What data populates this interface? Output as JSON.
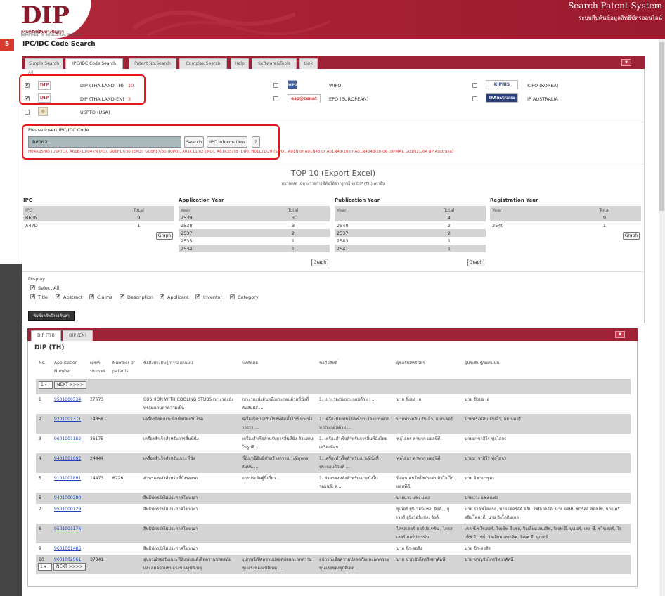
{
  "header": {
    "logo_text": "DIP",
    "logo_sub_th": "กรมทรัพย์สินทางปัญญา",
    "logo_sub_en": "DEPARTMENT OF INTELLECTUAL PROPERTY",
    "title": "Search Patent System",
    "subtitle": "ระบบสืบค้นข้อมูลสิทธิบัตรออนไลน์"
  },
  "step_badge": "5",
  "page_title": "IPC/IDC Code Search",
  "tabs": [
    "Simple Search",
    "IPC/IDC Code Search",
    "Patent No.Search",
    "Complex Search",
    "Help",
    "Software&Tools",
    "Link"
  ],
  "tab_toggle": "▼",
  "sources": {
    "all_label": "All",
    "items": [
      {
        "logo": "DIP",
        "label": "DIP (THAILAND-TH)",
        "count": "10",
        "checked": true
      },
      {
        "logo": "DIP",
        "label": "DIP (THAILAND-EN)",
        "count": "3",
        "checked": true
      },
      {
        "logo": "◎",
        "label": "USPTO (USA)",
        "count": "",
        "checked": false
      },
      {
        "logo": "WIPO",
        "label": "WIPO",
        "count": "",
        "checked": false
      },
      {
        "logo": "esp@cenet",
        "label": "EPO (EUROPEAN)",
        "count": "",
        "checked": false
      },
      {
        "logo": "KIPRIS",
        "label": "KIPO (KOREA)",
        "count": "",
        "checked": false
      },
      {
        "logo": "IPAustralia",
        "label": "IP AUSTRALIA",
        "count": "",
        "checked": false
      }
    ]
  },
  "ipc_search": {
    "label": "Please insert IPC/IDC Code",
    "value": "B60N2",
    "search_button": "Search",
    "info_button": "IPC information",
    "help_button": "?",
    "examples": "H04R25/00 (USPTO), A61B-10/04 (WIPO), G06F17/30 (EPO), G06F17/30 (KIPO), A01C11/02 (JPO), A61K35/78 (DIP), H01L21/20 (SIPO), A01N or A01N43 or A01N43/28 or A01N4343/28-06 (DPMA), G01N21/64 (IP Australia)"
  },
  "top10": {
    "title": "TOP 10 (Export Excel)",
    "note": "หมายเหตุ เฉพาะรายการที่ค้นได้จากฐานไทย DIP (TH) เท่านั้น",
    "graph_label": "Graph",
    "ipc": {
      "title": "IPC",
      "headers": [
        "IPC",
        "Total"
      ],
      "rows": [
        [
          "B60N",
          "9"
        ],
        [
          "A47D",
          "1"
        ]
      ]
    },
    "application_year": {
      "title": "Application Year",
      "headers": [
        "Year",
        "Total"
      ],
      "rows": [
        [
          "2539",
          "3"
        ],
        [
          "2538",
          "3"
        ],
        [
          "2537",
          "2"
        ],
        [
          "2535",
          "1"
        ],
        [
          "2534",
          "1"
        ]
      ]
    },
    "publication_year": {
      "title": "Publication Year",
      "headers": [
        "Year",
        "Total"
      ],
      "rows": [
        [
          "",
          "4"
        ],
        [
          "2540",
          "2"
        ],
        [
          "2537",
          "2"
        ],
        [
          "2543",
          "1"
        ],
        [
          "2541",
          "1"
        ]
      ]
    },
    "registration_year": {
      "title": "Registration Year",
      "headers": [
        "Year",
        "Total"
      ],
      "rows": [
        [
          "",
          "9"
        ],
        [
          "2540",
          "1"
        ]
      ]
    }
  },
  "display": {
    "label": "Display",
    "select_all": "Select All",
    "options": [
      "Title",
      "Abstract",
      "Claims",
      "Description",
      "Applicant",
      "Inventor",
      "Category"
    ]
  },
  "export_button": "พิมพ์ผลลัพธ์การค้นหา",
  "results": {
    "tabs": [
      "DIP (TH)",
      "DIP (EN)"
    ],
    "title": "DIP (TH)",
    "headers": [
      "No.",
      "Application Number",
      "เลขที่ประกาศ",
      "Number of patents.",
      "ชื่อสิ่งประดิษฐ์/การออกแบบ",
      "บทคัดย่อ",
      "ข้อถือสิทธิ์",
      "ผู้ขอรับสิทธิบัตร",
      "ผู้ประดิษฐ์/ออกแบบ"
    ],
    "pager": {
      "page": "1",
      "next": "NEXT >>>>"
    },
    "rows": [
      [
        "1",
        "9501000534",
        "27673",
        "",
        "CUSHION WITH COOLING STUBS เบาะรองนั่งพร้อมแกนทำความเย็น",
        "เบาะรองนั่งอันหนึ่งประกอบด้วยที่นั่งที่ดันสัมผัส ...",
        "1. เบาะรองนั่งประกอบด้วย : ...",
        "นาย ชิงชย เอ",
        "นาย ชิงชย เอ"
      ],
      [
        "2",
        "9201001371",
        "14858",
        "",
        "เครื่องมือที่เบาะนั่งเพื่อป้องกันโรค",
        "เครื่องมือป้องกันโรคที่ติดตั้งไว้ที่เบาะนั่งรองรา ...",
        "1. เครื่องป้องกันโรคที่เบาะรองอาบพากษ ประกอบด้วย ...",
        "นายฟรงคลิน ฮันเอ็ว, แมกเคอร์",
        "นายฟรงคลิน ฮันเอ็ว, แมกเคอร์"
      ],
      [
        "3",
        "9601003182",
        "26175",
        "",
        "เครื่องสำเร็จสำหรับการสิ้นที่นั่ง",
        "เครื่องสำเร็จสำหรับการสิ้นที่นั่ง ดังแสดงในรูปที่ ...",
        "1. เครื่องสำเร็จสำหรับการสิ้นที่นั่งโดยเครื่องมือก ...",
        "ฟุลุไอกร คาทาก แอสทีดี.",
        "นายมาชาฮิโร ฟุลุไอกร"
      ],
      [
        "4",
        "9401001092",
        "24444",
        "",
        "เครื่องสำเร็จสำหรับเบาะที่นั่ง",
        "ที่นั่งเหนียินมีตัวสร้างการเบาะที่ถูกตอกันที่นี่ ...",
        "1. เครื่องสำเร็จสำหรับเบาะที่นั่งที่ประกอบด้วยที่ ...",
        "ฟุลุไอกร คาทาก แอสทีดี.",
        "นายมาชาฮิโร ฟุลุไอกร"
      ],
      [
        "5",
        "9101001891",
        "14473",
        "6726",
        "ส่วนรองหลังสำหรับที่นั่งรองรถ",
        "การประดิษฐ์นี้เกี่ยว ...",
        "1. ส่วนรองหลังสำหรับเบาะนั่งในรถยนต์, ส่ ...",
        "นิสอนเคนโคโชบันเคนคิวโจ โก., แอลทีดี.",
        "นาย อิชามาซูตะ"
      ],
      [
        "6",
        "9401000200",
        "",
        "",
        "สิทธิบัตรยังไม่ประกาศโฆษณา",
        "",
        "",
        "นายแวง แชง แฟง",
        "นายแวง แชง แฟง"
      ],
      [
        "7",
        "9501000129",
        "",
        "",
        "สิทธิบัตรยังไม่ประกาศโฆษณา",
        "",
        "",
        "ซูเวอร์ ยูนิเวอร์แซล, อิงค์, , ยู เวอร์ ยูนิเวอร์แซล, อิงค์.",
        "นาย ราล์ฟโฮแกล, นาย เจอร์ลด์ อลัน ไซมิเออร์ดี, นาย จอห์น ชาร์ลส์ สตีลไซ, นาย คริสอินโคลาดี, นาย ฮิงโกดินเกอ"
      ],
      [
        "8",
        "9501003176",
        "",
        "",
        "สิทธิบัตรยังไม่ประกาศโฆษณา",
        "",
        "",
        "ไครสเลอร์ คอร์ปอเรชัน , ไครสเลอร์ คอร์ปอเรชัน",
        "เคล ซี.ชโรเดอร์, โจเซ็ฟ อี.เชย์, วิลเลียม ลนเลิฟ, จิเจฟ อี. นูเบอร์, เคล ซี. ชโรเดอร์, โจเซ็ฟ อี. เชย์, วิลเลียม เลนเลิฟ, จิเจฟ อี. นูเบอร์"
      ],
      [
        "9",
        "9601001486",
        "",
        "",
        "สิทธิบัตรยังไม่ประกาศโฆษณา",
        "",
        "",
        "นาย ชิก-ฮอลิง",
        "นาย ชิก-ฮอลิง"
      ],
      [
        "10",
        "9601002561",
        "37841",
        "",
        "อุปกรณ์รองรับเบาะที่นั่งรถยนต์เพื่อความปลอดภัยและลดความชุนแรงของอุบัติเหตุ",
        "อุปกรณ์เพื่อความปลอดภัยและลดความชุนแรงของอุบัติเหต ...",
        "อุปกรณ์เพื่อความปลอดภัยและลดความชุนแรงของอุบัติเหต ...",
        "นาย ชาญชัยไตรวิทยาคัดนี",
        "นาย ชาญชัยไตรวิทยาคัดนี"
      ]
    ]
  }
}
